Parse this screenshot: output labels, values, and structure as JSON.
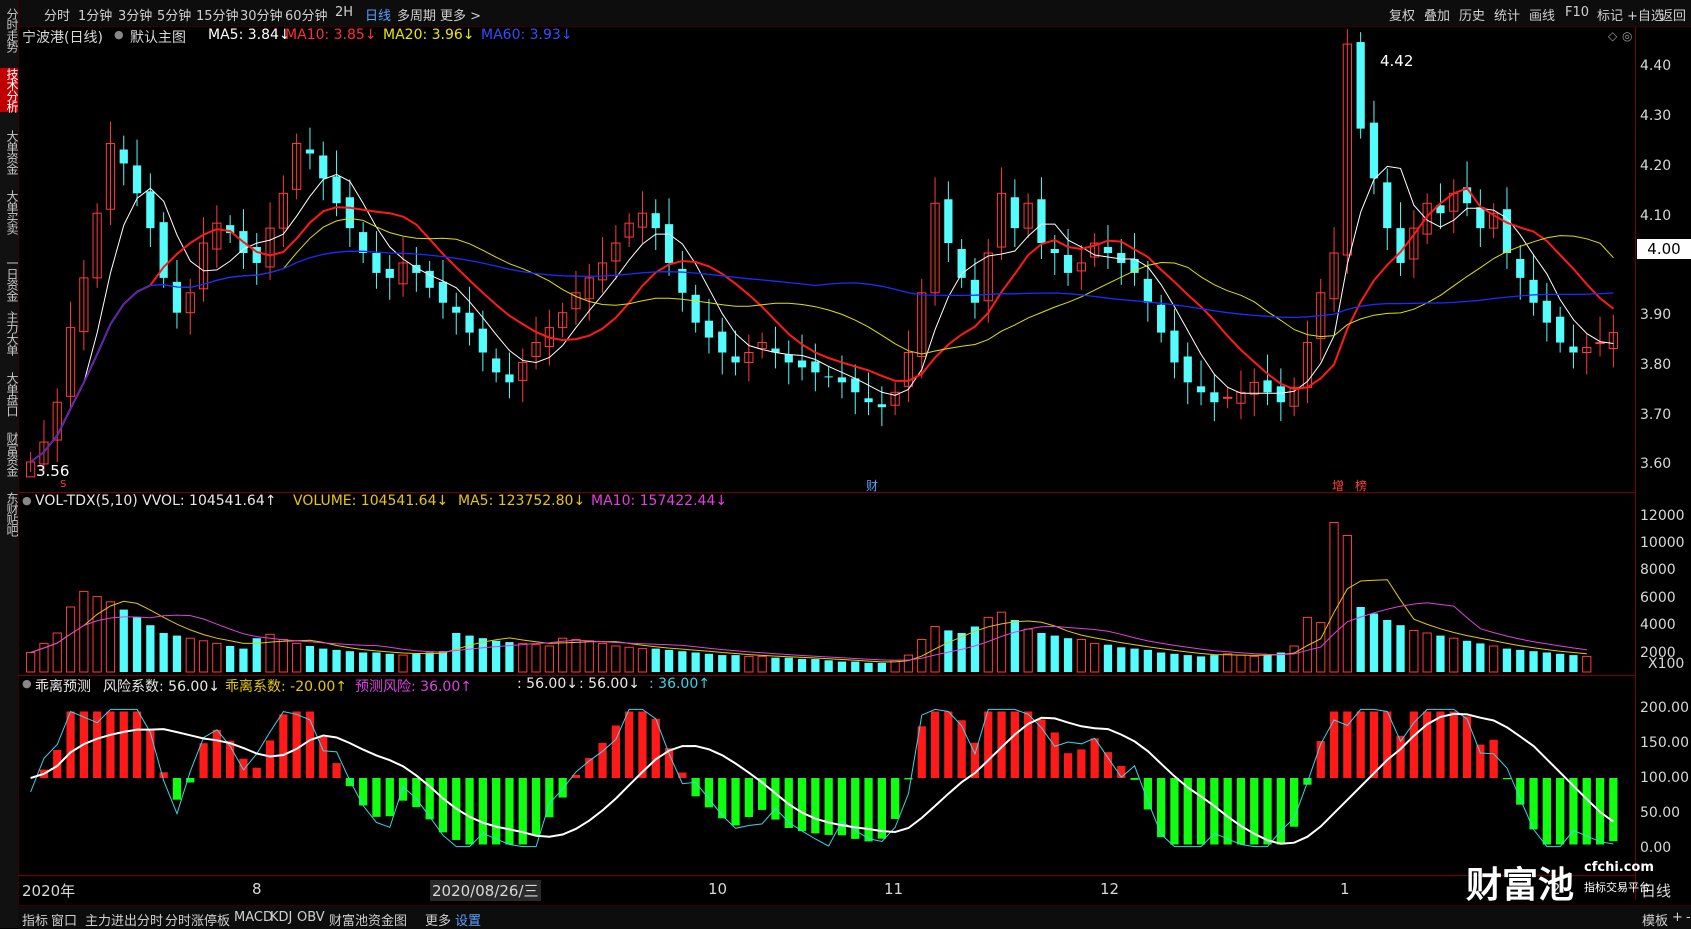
{
  "toolbar": {
    "tabs": [
      "分时",
      "1分钟",
      "3分钟",
      "5分钟",
      "15分钟",
      "30分钟",
      "60分钟",
      "2H",
      "日线",
      "多周期",
      "更多"
    ],
    "active_tab": "日线",
    "right_tools": [
      "复权",
      "叠加",
      "历史",
      "统计",
      "画线",
      "F10",
      "标记",
      "+自选",
      "返回"
    ]
  },
  "left_nav": [
    "分时走势",
    "技术分析",
    "大单资金",
    "大单买卖",
    "一日资金",
    "主力大单",
    "大单盘口",
    "财富资金",
    "东财贴吧"
  ],
  "left_nav_selected": "技术分析",
  "main_panel": {
    "stock_name": "宁波港(日线)",
    "template": "默认主图",
    "ma5": "MA5: 3.84↓",
    "ma10": "MA10: 3.85↓",
    "ma20": "MA20: 3.96↓",
    "ma60": "MA60: 3.93↓",
    "high_label": "4.42",
    "low_label": "3.56",
    "current_price": "4.00",
    "marker_cai": "财",
    "marker_zeng": "增",
    "marker_bang": "榜",
    "marker_s": "S",
    "colors": {
      "ma5": "#ffffff",
      "ma10": "#ff1a1a",
      "ma20": "#e0e000",
      "ma60": "#1a2cff",
      "up": "#ff3b3b",
      "down": "#54fcfc"
    }
  },
  "volume_panel": {
    "label": "VOL-TDX(5,10) VVOL: 104541.64↑",
    "volume": "VOLUME: 104541.64↓",
    "ma5": "MA5: 123752.80↓",
    "ma10": "MA10: 157422.44↓",
    "unit": "X100"
  },
  "indicator_panel": {
    "name": "乖离预测",
    "risk": "风险系数: 56.00↓",
    "bias": "乖离系数: -20.00↑",
    "predict": "预测风险: 36.00↑",
    "v1": ": 56.00↓",
    "v2": ": 56.00↓",
    "v3": ": 36.00↑"
  },
  "price_axis": [
    "4.40",
    "4.30",
    "4.20",
    "4.10",
    "4.00",
    "3.90",
    "3.80",
    "3.70",
    "3.60"
  ],
  "volume_axis": [
    "12000",
    "10000",
    "8000",
    "6000",
    "4000",
    "2000"
  ],
  "indicator_axis": [
    "200.00",
    "150.00",
    "100.00",
    "50.00",
    "0.00"
  ],
  "x_axis_labels": [
    "2020年",
    "8",
    "2020/08/26/三",
    "10",
    "11",
    "12",
    "1",
    "2"
  ],
  "period_label": "日线",
  "bottom_tabs": [
    "指标",
    "窗口",
    "主力进出分时",
    "分时涨停板",
    "MACD",
    "KDJ",
    "OBV",
    "财富池资金图",
    "更多",
    "设置"
  ],
  "bottom_active": "设置",
  "bottom_right": [
    "模板",
    "+",
    "-"
  ],
  "watermark": {
    "brand": "财富池",
    "site": "cfchi.com",
    "tagline": "指标交易平台"
  },
  "chart_data": {
    "type": "candlestick",
    "symbol": "宁波港",
    "period": "日线",
    "ylim": [
      3.5,
      4.45
    ],
    "price_high": 4.42,
    "price_low": 3.56,
    "closes": [
      3.58,
      3.62,
      3.7,
      3.85,
      3.95,
      4.08,
      4.22,
      4.18,
      4.12,
      4.05,
      3.95,
      3.88,
      3.92,
      4.02,
      4.06,
      4.04,
      4.0,
      3.98,
      4.05,
      4.12,
      4.22,
      4.2,
      4.15,
      4.1,
      4.05,
      4.0,
      3.96,
      3.95,
      3.98,
      3.96,
      3.93,
      3.9,
      3.88,
      3.84,
      3.8,
      3.76,
      3.74,
      3.78,
      3.82,
      3.85,
      3.88,
      3.92,
      3.95,
      3.98,
      4.02,
      4.06,
      4.08,
      4.05,
      3.98,
      3.92,
      3.86,
      3.83,
      3.8,
      3.78,
      3.8,
      3.82,
      3.8,
      3.78,
      3.77,
      3.76,
      3.75,
      3.74,
      3.72,
      3.7,
      3.69,
      3.72,
      3.8,
      3.92,
      4.1,
      4.02,
      3.95,
      3.9,
      4.0,
      4.12,
      4.05,
      4.1,
      4.02,
      4.0,
      3.96,
      3.98,
      4.02,
      4.0,
      3.98,
      3.96,
      3.9,
      3.84,
      3.78,
      3.74,
      3.72,
      3.7,
      3.71,
      3.72,
      3.74,
      3.72,
      3.7,
      3.73,
      3.82,
      3.92,
      4.0,
      4.42,
      4.25,
      4.15,
      4.05,
      3.98,
      4.05,
      4.1,
      4.08,
      4.12,
      4.1,
      4.05,
      4.08,
      4.0,
      3.95,
      3.9,
      3.86,
      3.82,
      3.8,
      3.81,
      3.82,
      3.84
    ],
    "volume": [
      1500,
      2200,
      3000,
      5000,
      6200,
      5800,
      5400,
      4800,
      4200,
      3600,
      3000,
      2800,
      2600,
      2400,
      2200,
      2000,
      1800,
      2600,
      2900,
      2500,
      2200,
      2000,
      1800,
      1700,
      1600,
      1500,
      1500,
      1400,
      1300,
      1400,
      1500,
      1600,
      3000,
      2800,
      2600,
      2400,
      2300,
      2200,
      2100,
      2000,
      2600,
      2500,
      2400,
      2200,
      2000,
      1900,
      1800,
      1800,
      1700,
      1600,
      1500,
      1400,
      1300,
      1300,
      1200,
      1200,
      1100,
      1100,
      1000,
      1000,
      900,
      800,
      800,
      700,
      700,
      900,
      1300,
      2500,
      3500,
      3200,
      3000,
      3500,
      4200,
      4600,
      4000,
      3300,
      3000,
      2800,
      2600,
      2500,
      2200,
      2100,
      1900,
      1800,
      1700,
      1500,
      1400,
      1300,
      1200,
      1300,
      1400,
      1300,
      1200,
      1300,
      1500,
      2000,
      4200,
      3800,
      11500,
      10500,
      5000,
      4500,
      4000,
      3600,
      3200,
      3000,
      2800,
      2600,
      2400,
      2200,
      2000,
      1800,
      1700,
      1600,
      1500,
      1400,
      1300,
      1200
    ],
    "indicator_series": [
      {
        "name": "风险系数",
        "last": 56.0
      },
      {
        "name": "乖离系数",
        "last": -20.0
      },
      {
        "name": "预测风险",
        "last": 36.0
      }
    ]
  }
}
